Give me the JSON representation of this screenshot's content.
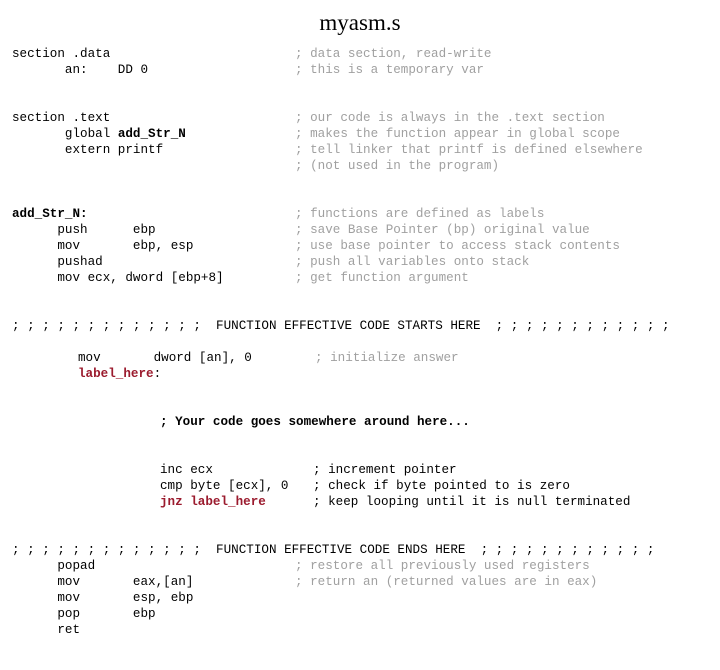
{
  "title": "myasm.s",
  "colors": {
    "text": "#000000",
    "comment_gray": "#a0a0a0",
    "label_red": "#9b1b2e",
    "background": "#ffffff"
  },
  "code": {
    "data_section": {
      "line1_code": "section .data",
      "line1_comment": "; data section, read-write",
      "line2_code": "       an:    DD 0",
      "line2_comment": "; this is a temporary var"
    },
    "text_section": {
      "line1_code": "section .text",
      "line1_comment": "; our code is always in the .text section",
      "line2_code_prefix": "       global ",
      "line2_code_symbol": "add_Str_N",
      "line2_comment": "; makes the function appear in global scope",
      "line3_code": "       extern printf",
      "line3_comment": "; tell linker that printf is defined elsewhere",
      "line4_comment": "; (not used in the program)"
    },
    "function": {
      "label": "add_Str_N:",
      "label_comment": "; functions are defined as labels",
      "line1_code": "      push      ebp",
      "line1_comment": "; save Base Pointer (bp) original value",
      "line2_code": "      mov       ebp, esp",
      "line2_comment": "; use base pointer to access stack contents",
      "line3_code": "      pushad",
      "line3_comment": "; push all variables onto stack",
      "line4_code": "      mov ecx, dword [ebp+8]",
      "line4_comment": "; get function argument"
    },
    "banner_start": "; ; ; ; ; ; ; ; ; ; ; ; ;  FUNCTION EFFECTIVE CODE STARTS HERE  ; ; ; ; ; ; ; ; ; ; ; ;",
    "banner_end": "; ; ; ; ; ; ; ; ; ; ; ; ;  FUNCTION EFFECTIVE CODE ENDS HERE  ; ; ; ; ; ; ; ; ; ; ; ;",
    "init": {
      "code": "mov       dword [an], 0",
      "comment": "; initialize answer",
      "label_symbol": "label_here",
      "label_colon": ":"
    },
    "your_code_note": "; Your code goes somewhere around here...",
    "loop": {
      "line1_code": "inc ecx",
      "line1_comment": "; increment pointer",
      "line2_code": "cmp byte [ecx], 0",
      "line2_comment": "; check if byte pointed to is zero",
      "line3_mnemonic": "jnz",
      "line3_operand": "label_here",
      "line3_comment": "; keep looping until it is null terminated"
    },
    "epilogue": {
      "line1_code": "      popad",
      "line1_comment": "; restore all previously used registers",
      "line2_code": "      mov       eax,[an]",
      "line2_comment": "; return an (returned values are in eax)",
      "line3_code": "      mov       esp, ebp",
      "line4_code": "      pop       ebp",
      "line5_code": "      ret"
    }
  }
}
